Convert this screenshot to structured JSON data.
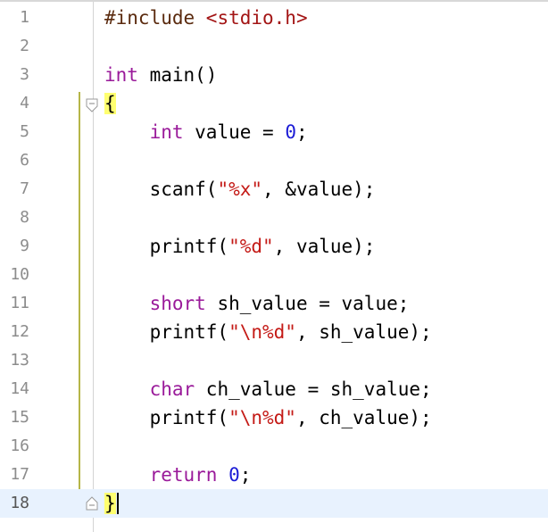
{
  "editor": {
    "lines": [
      {
        "n": "1",
        "tokens": [
          [
            "pre",
            "#include "
          ],
          [
            "inc",
            "<stdio.h>"
          ]
        ]
      },
      {
        "n": "2",
        "tokens": []
      },
      {
        "n": "3",
        "tokens": [
          [
            "kw",
            "int"
          ],
          [
            "plain",
            " main()"
          ]
        ]
      },
      {
        "n": "4",
        "tokens": [
          [
            "brace",
            "{"
          ]
        ]
      },
      {
        "n": "5",
        "tokens": [
          [
            "plain",
            "    "
          ],
          [
            "kw",
            "int"
          ],
          [
            "plain",
            " value = "
          ],
          [
            "num",
            "0"
          ],
          [
            "plain",
            ";"
          ]
        ]
      },
      {
        "n": "6",
        "tokens": []
      },
      {
        "n": "7",
        "tokens": [
          [
            "plain",
            "    scanf("
          ],
          [
            "str",
            "\"%x\""
          ],
          [
            "plain",
            ", &value);"
          ]
        ]
      },
      {
        "n": "8",
        "tokens": []
      },
      {
        "n": "9",
        "tokens": [
          [
            "plain",
            "    printf("
          ],
          [
            "str",
            "\"%d\""
          ],
          [
            "plain",
            ", value);"
          ]
        ]
      },
      {
        "n": "10",
        "tokens": []
      },
      {
        "n": "11",
        "tokens": [
          [
            "plain",
            "    "
          ],
          [
            "kw",
            "short"
          ],
          [
            "plain",
            " sh_value = value;"
          ]
        ]
      },
      {
        "n": "12",
        "tokens": [
          [
            "plain",
            "    printf("
          ],
          [
            "str",
            "\"\\n%d\""
          ],
          [
            "plain",
            ", sh_value);"
          ]
        ]
      },
      {
        "n": "13",
        "tokens": []
      },
      {
        "n": "14",
        "tokens": [
          [
            "plain",
            "    "
          ],
          [
            "kw",
            "char"
          ],
          [
            "plain",
            " ch_value = sh_value;"
          ]
        ]
      },
      {
        "n": "15",
        "tokens": [
          [
            "plain",
            "    printf("
          ],
          [
            "str",
            "\"\\n%d\""
          ],
          [
            "plain",
            ", ch_value);"
          ]
        ]
      },
      {
        "n": "16",
        "tokens": []
      },
      {
        "n": "17",
        "tokens": [
          [
            "plain",
            "    "
          ],
          [
            "kw",
            "return"
          ],
          [
            "plain",
            " "
          ],
          [
            "num",
            "0"
          ],
          [
            "plain",
            ";"
          ]
        ]
      },
      {
        "n": "18",
        "tokens": [
          [
            "brace",
            "}"
          ]
        ],
        "current": true
      }
    ]
  },
  "colors": {
    "keyword": "#9a1a9a",
    "string": "#c41a16",
    "number": "#1b1bd6",
    "preprocessor": "#5a2a0e",
    "include_path": "#a31515",
    "current_line_bg": "#e8f2fe",
    "brace_highlight": "#ffff70",
    "scope_bar": "#b5b548"
  },
  "icons": {
    "fold_open": "fold-expanded-icon",
    "fold_close": "fold-end-icon"
  }
}
